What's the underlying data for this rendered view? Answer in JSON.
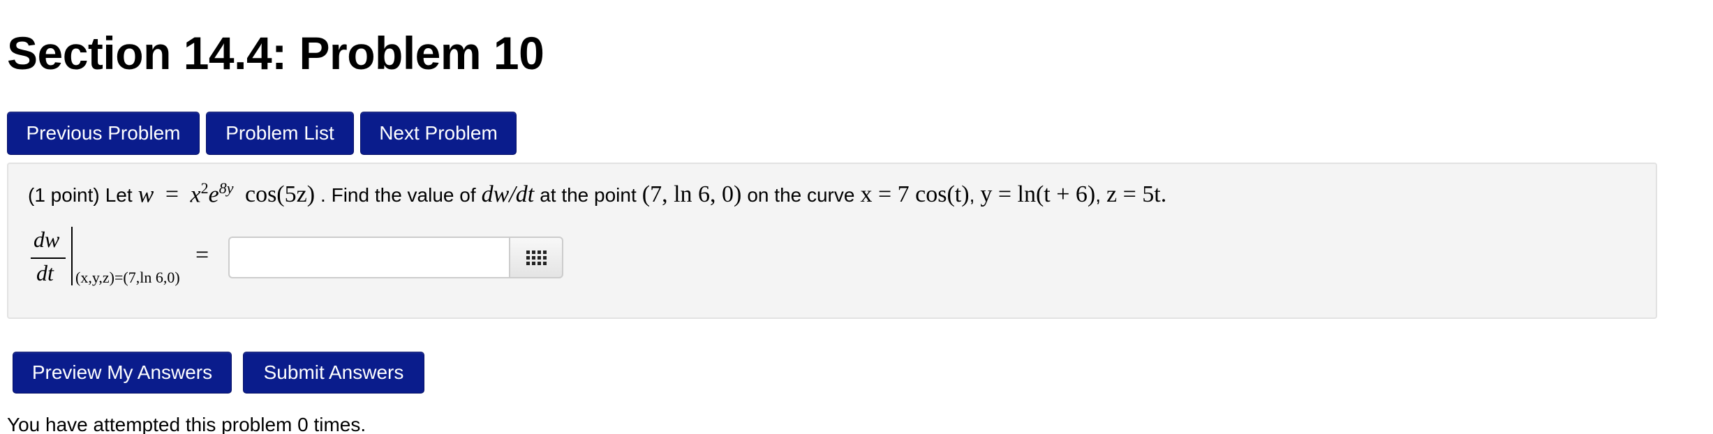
{
  "title": "Section 14.4: Problem 10",
  "nav": {
    "previous_label": "Previous Problem",
    "list_label": "Problem List",
    "next_label": "Next Problem"
  },
  "problem": {
    "points": "(1 point)",
    "let_text": "Let",
    "w": "w",
    "eq": "=",
    "x": "x",
    "x_exp": "2",
    "e": "e",
    "e_exp": "8y",
    "cos_expr": "cos(5z)",
    "find_text": ". Find the value of",
    "deriv_inline": "dw/dt",
    "at_point_text": "at the point",
    "point": "(7, ln 6, 0)",
    "on_curve_text": "on the curve",
    "curve_x": "x = 7 cos(t)",
    "curve_y": "y = ln(t + 6)",
    "curve_z": "z = 5t",
    "comma": ",",
    "period": "."
  },
  "answer": {
    "numerator": "dw",
    "denominator": "dt",
    "eval_at": "(x,y,z)=(7,ln 6,0)",
    "equals": "=",
    "value": "",
    "placeholder": ""
  },
  "actions": {
    "preview_label": "Preview My Answers",
    "submit_label": "Submit Answers"
  },
  "status": {
    "attempts_text": "You have attempted this problem 0 times."
  },
  "colors": {
    "button_bg": "#0a1c8c",
    "panel_bg": "#f4f4f4"
  },
  "icons": {
    "palette": "grid-icon"
  }
}
